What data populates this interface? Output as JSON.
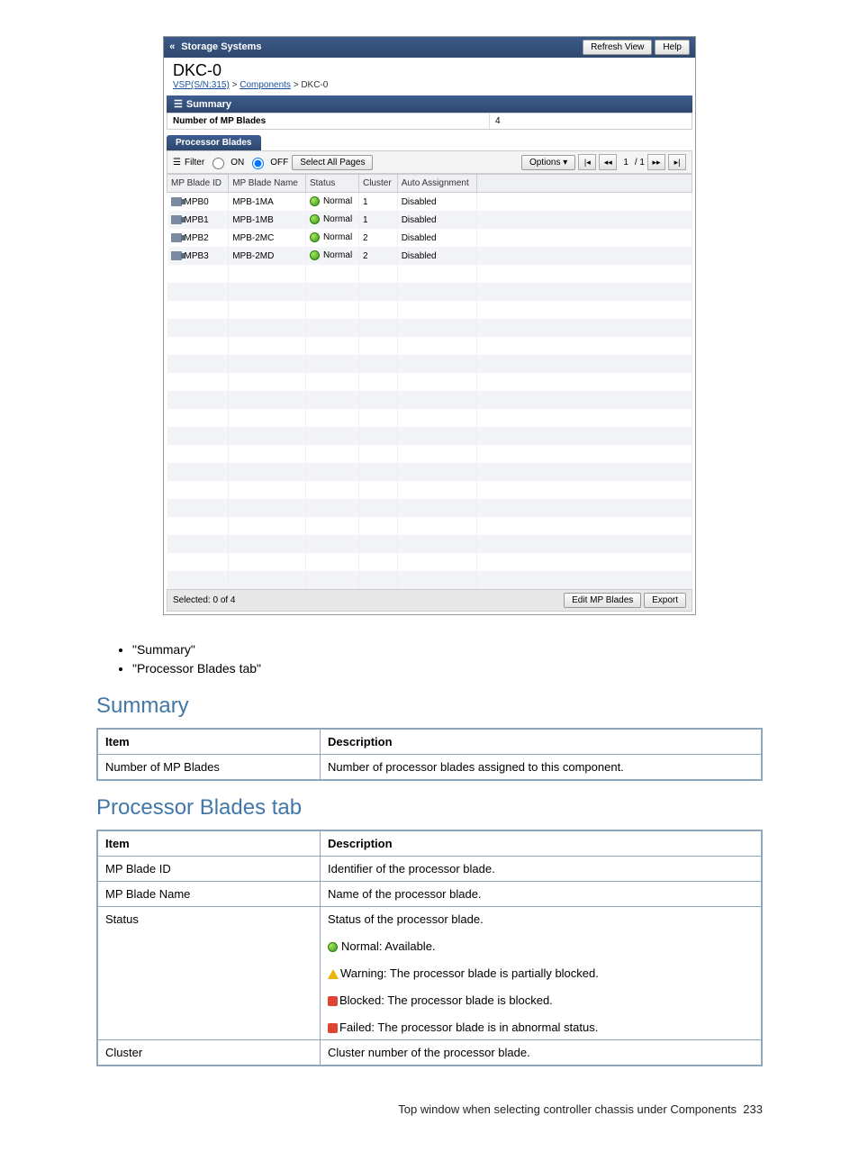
{
  "topbar": {
    "title": "Storage Systems",
    "refresh": "Refresh View",
    "help": "Help"
  },
  "page": {
    "title": "DKC-0"
  },
  "breadcrumb": {
    "a": "VSP(S/N:315)",
    "b": "Components",
    "c": "DKC-0",
    "sep": ">"
  },
  "summary": {
    "header": "Summary",
    "label": "Number of MP Blades",
    "value": "4"
  },
  "tab": {
    "label": "Processor Blades"
  },
  "toolbar": {
    "filter": "Filter",
    "on": "ON",
    "off": "OFF",
    "selectAll": "Select All Pages",
    "options": "Options",
    "pageNum": "1",
    "pageTotal": "/ 1"
  },
  "columns": {
    "c1": "MP Blade ID",
    "c2": "MP Blade Name",
    "c3": "Status",
    "c4": "Cluster",
    "c5": "Auto Assignment"
  },
  "rows": [
    {
      "id": "MPB0",
      "name": "MPB-1MA",
      "status": "Normal",
      "cluster": "1",
      "auto": "Disabled"
    },
    {
      "id": "MPB1",
      "name": "MPB-1MB",
      "status": "Normal",
      "cluster": "1",
      "auto": "Disabled"
    },
    {
      "id": "MPB2",
      "name": "MPB-2MC",
      "status": "Normal",
      "cluster": "2",
      "auto": "Disabled"
    },
    {
      "id": "MPB3",
      "name": "MPB-2MD",
      "status": "Normal",
      "cluster": "2",
      "auto": "Disabled"
    }
  ],
  "footer": {
    "selected": "Selected: 0   of 4",
    "edit": "Edit MP Blades",
    "export": "Export"
  },
  "doc": {
    "bullets": {
      "a": "\"Summary\"",
      "b": "\"Processor Blades tab\""
    },
    "h1": "Summary",
    "t1": {
      "hItem": "Item",
      "hDesc": "Description",
      "r1a": "Number of MP Blades",
      "r1b": "Number of processor blades assigned to this component."
    },
    "h2": "Processor Blades tab",
    "t2": {
      "hItem": "Item",
      "hDesc": "Description",
      "r1a": "MP Blade ID",
      "r1b": "Identifier of the processor blade.",
      "r2a": "MP Blade Name",
      "r2b": "Name of the processor blade.",
      "r3a": "Status",
      "r3b1": "Status of the processor blade.",
      "r3b2": "Normal: Available.",
      "r3b3": "Warning: The processor blade is partially blocked.",
      "r3b4": "Blocked: The processor blade is blocked.",
      "r3b5": "Failed: The processor blade is in abnormal status.",
      "r4a": "Cluster",
      "r4b": "Cluster number of the processor blade."
    }
  },
  "pagefoot": {
    "text": "Top window when selecting controller chassis under Components",
    "num": "233"
  }
}
